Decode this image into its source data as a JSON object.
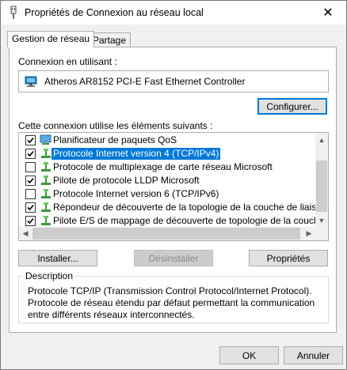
{
  "window": {
    "title": "Propriétés de Connexion au réseau local",
    "close_glyph": "✕",
    "icon": "network-adapter-icon"
  },
  "tabs": [
    {
      "label": "Gestion de réseau",
      "active": true
    },
    {
      "label": "Partage",
      "active": false
    }
  ],
  "connection": {
    "label": "Connexion en utilisant :",
    "adapter_name": "Atheros AR8152 PCI-E Fast Ethernet Controller",
    "configure_button": "Configurer..."
  },
  "items_section": {
    "label": "Cette connexion utilise les éléments suivants :",
    "items": [
      {
        "label": "Planificateur de paquets QoS",
        "checked": true,
        "selected": false,
        "icon": "qos-icon"
      },
      {
        "label": "Protocole Internet version 4 (TCP/IPv4)",
        "checked": true,
        "selected": true,
        "icon": "protocol-icon"
      },
      {
        "label": "Protocole de multiplexage de carte réseau Microsoft",
        "checked": false,
        "selected": false,
        "icon": "protocol-icon"
      },
      {
        "label": "Pilote de protocole LLDP Microsoft",
        "checked": true,
        "selected": false,
        "icon": "protocol-icon"
      },
      {
        "label": "Protocole Internet version 6 (TCP/IPv6)",
        "checked": false,
        "selected": false,
        "icon": "protocol-icon"
      },
      {
        "label": "Répondeur de découverte de la topologie de la couche de liaison",
        "checked": true,
        "selected": false,
        "icon": "protocol-icon"
      },
      {
        "label": "Pilote E/S de mappage de découverte de topologie de la couche de liaiso",
        "checked": true,
        "selected": false,
        "icon": "protocol-icon"
      }
    ]
  },
  "actions": {
    "install": "Installer...",
    "uninstall": "Désinstaller",
    "properties": "Propriétés"
  },
  "description": {
    "title": "Description",
    "text": "Protocole TCP/IP (Transmission Control Protocol/Internet Protocol). Protocole de réseau étendu par défaut permettant la communication entre différents réseaux interconnectés."
  },
  "footer": {
    "ok": "OK",
    "cancel": "Annuler"
  },
  "colors": {
    "selection": "#0078d7",
    "protocol_icon": "#3c9a3c",
    "monitor_icon": "#1e88c8"
  }
}
